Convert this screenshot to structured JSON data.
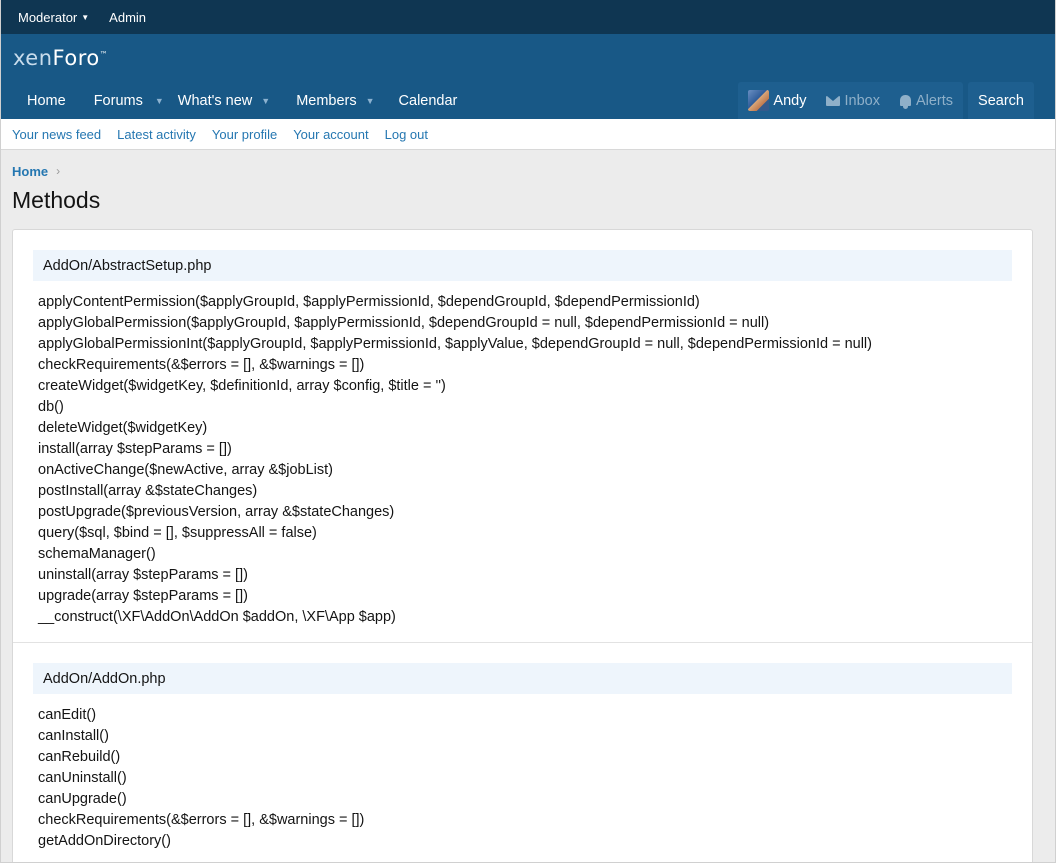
{
  "staff_bar": {
    "moderator": "Moderator",
    "admin": "Admin"
  },
  "logo": {
    "part1": "xen",
    "part2": "Foro",
    "tm": "™"
  },
  "nav": {
    "tabs": [
      {
        "label": "Home",
        "has_menu": false
      },
      {
        "label": "Forums",
        "has_menu": true
      },
      {
        "label": "What's new",
        "has_menu": true
      },
      {
        "label": "Members",
        "has_menu": true
      },
      {
        "label": "Calendar",
        "has_menu": false
      }
    ],
    "user": "Andy",
    "inbox": "Inbox",
    "alerts": "Alerts",
    "search": "Search"
  },
  "subnav": {
    "links": [
      "Your news feed",
      "Latest activity",
      "Your profile",
      "Your account",
      "Log out"
    ]
  },
  "breadcrumb": {
    "home": "Home"
  },
  "page_title": "Methods",
  "sections": [
    {
      "file": "AddOn/AbstractSetup.php",
      "methods": [
        "applyContentPermission($applyGroupId, $applyPermissionId, $dependGroupId, $dependPermissionId)",
        "applyGlobalPermission($applyGroupId, $applyPermissionId, $dependGroupId = null, $dependPermissionId = null)",
        "applyGlobalPermissionInt($applyGroupId, $applyPermissionId, $applyValue, $dependGroupId = null, $dependPermissionId = null)",
        "checkRequirements(&$errors = [], &$warnings = [])",
        "createWidget($widgetKey, $definitionId, array $config, $title = '')",
        "db()",
        "deleteWidget($widgetKey)",
        "install(array $stepParams = [])",
        "onActiveChange($newActive, array &$jobList)",
        "postInstall(array &$stateChanges)",
        "postUpgrade($previousVersion, array &$stateChanges)",
        "query($sql, $bind = [], $suppressAll = false)",
        "schemaManager()",
        "uninstall(array $stepParams = [])",
        "upgrade(array $stepParams = [])",
        "__construct(\\XF\\AddOn\\AddOn $addOn, \\XF\\App $app)"
      ]
    },
    {
      "file": "AddOn/AddOn.php",
      "methods": [
        "canEdit()",
        "canInstall()",
        "canRebuild()",
        "canUninstall()",
        "canUpgrade()",
        "checkRequirements(&$errors = [], &$warnings = [])",
        "getAddOnDirectory()"
      ]
    }
  ]
}
